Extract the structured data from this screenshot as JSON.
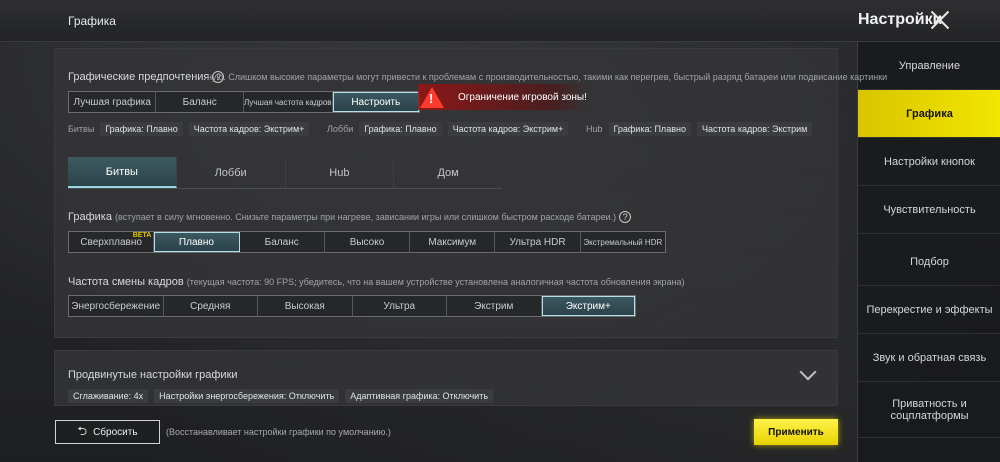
{
  "header": {
    "section_title": "Графика",
    "settings_title": "Настройки"
  },
  "sidebar": {
    "items": [
      {
        "label": "Управление"
      },
      {
        "label": "Графика"
      },
      {
        "label": "Настройки кнопок"
      },
      {
        "label": "Чувствительность"
      },
      {
        "label": "Подбор"
      },
      {
        "label": "Перекрестие и эффекты"
      },
      {
        "label": "Звук и обратная связь"
      },
      {
        "label": "Приватность и соцплатформы"
      }
    ],
    "active": "Графика"
  },
  "preferences": {
    "label": "Графические предпочтения",
    "hint": "ную. Слишком высокие параметры могут привести к проблемам с производительностью, такими как перегрев, быстрый разряд батареи или подвисание картинки",
    "options": [
      "Лучшая графика",
      "Баланс",
      "Лучшая частота кадров",
      "Настроить"
    ],
    "selected": "Настроить"
  },
  "warning": {
    "text": "Ограничение игровой зоны!"
  },
  "mode_info": {
    "battles": {
      "label": "Битвы",
      "graphics": "Графика: Плавно",
      "fps": "Частота кадров: Экстрим+"
    },
    "lobby": {
      "label": "Лобби",
      "graphics": "Графика: Плавно",
      "fps": "Частота кадров: Экстрим+"
    },
    "hub": {
      "label": "Hub",
      "graphics": "Графика: Плавно",
      "fps": "Частота кадров: Экстрим"
    }
  },
  "tabs": {
    "items": [
      "Битвы",
      "Лобби",
      "Hub",
      "Дом"
    ],
    "selected": "Битвы"
  },
  "graphics": {
    "label": "Графика",
    "hint": "(вступает в силу мгновенно. Снизьте параметры при нагреве, зависании игры или слишком быстром расходе батареи.)",
    "options": [
      "Сверхплавно",
      "Плавно",
      "Баланс",
      "Высоко",
      "Максимум",
      "Ультра HDR",
      "Экстремальный HDR"
    ],
    "beta_label": "BETA",
    "selected": "Плавно"
  },
  "framerate": {
    "label": "Частота смены кадров",
    "hint": "(текущая частота: 90 FPS; убедитесь, что на вашем устройстве установлена аналогичная частота обновления экрана)",
    "options": [
      "Энергосбережение",
      "Средняя",
      "Высокая",
      "Ультра",
      "Экстрим",
      "Экстрим+"
    ],
    "selected": "Экстрим+"
  },
  "advanced": {
    "title": "Продвинутые настройки графики",
    "chips": [
      "Сглаживание: 4x",
      "Настройки энергосбережения: Отключить",
      "Адаптивная графика: Отключить"
    ]
  },
  "footer": {
    "reset_label": "Сбросить",
    "reset_hint": "(Восстанавливает настройки графики по умолчанию.)",
    "apply_label": "Применить"
  }
}
